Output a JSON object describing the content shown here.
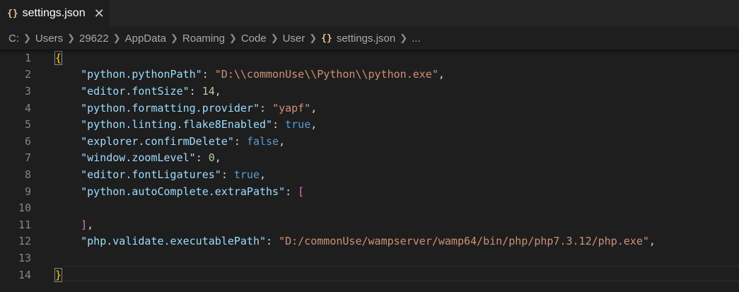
{
  "tab": {
    "icon": "{}",
    "label": "settings.json",
    "close": "✕"
  },
  "breadcrumbs": {
    "items": [
      "C:",
      "Users",
      "29622",
      "AppData",
      "Roaming",
      "Code",
      "User"
    ],
    "file_icon": "{}",
    "file": "settings.json",
    "more": "..."
  },
  "editor": {
    "lines": [
      {
        "n": "1",
        "tokens": [
          {
            "t": "{",
            "c": "brace"
          }
        ]
      },
      {
        "n": "2",
        "tokens": [
          {
            "t": "    ",
            "c": "punc"
          },
          {
            "t": "\"python.pythonPath\"",
            "c": "key"
          },
          {
            "t": ": ",
            "c": "punc"
          },
          {
            "t": "\"D:\\\\commonUse\\\\Python\\\\python.exe\"",
            "c": "str"
          },
          {
            "t": ",",
            "c": "punc"
          }
        ]
      },
      {
        "n": "3",
        "tokens": [
          {
            "t": "    ",
            "c": "punc"
          },
          {
            "t": "\"editor.fontSize\"",
            "c": "key"
          },
          {
            "t": ": ",
            "c": "punc"
          },
          {
            "t": "14",
            "c": "num"
          },
          {
            "t": ",",
            "c": "punc"
          }
        ]
      },
      {
        "n": "4",
        "tokens": [
          {
            "t": "    ",
            "c": "punc"
          },
          {
            "t": "\"python.formatting.provider\"",
            "c": "key"
          },
          {
            "t": ": ",
            "c": "punc"
          },
          {
            "t": "\"yapf\"",
            "c": "str"
          },
          {
            "t": ",",
            "c": "punc"
          }
        ]
      },
      {
        "n": "5",
        "tokens": [
          {
            "t": "    ",
            "c": "punc"
          },
          {
            "t": "\"python.linting.flake8Enabled\"",
            "c": "key"
          },
          {
            "t": ": ",
            "c": "punc"
          },
          {
            "t": "true",
            "c": "bool"
          },
          {
            "t": ",",
            "c": "punc"
          }
        ]
      },
      {
        "n": "6",
        "tokens": [
          {
            "t": "    ",
            "c": "punc"
          },
          {
            "t": "\"explorer.confirmDelete\"",
            "c": "key"
          },
          {
            "t": ": ",
            "c": "punc"
          },
          {
            "t": "false",
            "c": "bool"
          },
          {
            "t": ",",
            "c": "punc"
          }
        ]
      },
      {
        "n": "7",
        "tokens": [
          {
            "t": "    ",
            "c": "punc"
          },
          {
            "t": "\"window.zoomLevel\"",
            "c": "key"
          },
          {
            "t": ": ",
            "c": "punc"
          },
          {
            "t": "0",
            "c": "num"
          },
          {
            "t": ",",
            "c": "punc"
          }
        ]
      },
      {
        "n": "8",
        "tokens": [
          {
            "t": "    ",
            "c": "punc"
          },
          {
            "t": "\"editor.fontLigatures\"",
            "c": "key"
          },
          {
            "t": ": ",
            "c": "punc"
          },
          {
            "t": "true",
            "c": "bool"
          },
          {
            "t": ",",
            "c": "punc"
          }
        ]
      },
      {
        "n": "9",
        "tokens": [
          {
            "t": "    ",
            "c": "punc"
          },
          {
            "t": "\"python.autoComplete.extraPaths\"",
            "c": "key"
          },
          {
            "t": ": ",
            "c": "punc"
          },
          {
            "t": "[",
            "c": "bracket"
          }
        ]
      },
      {
        "n": "10",
        "tokens": []
      },
      {
        "n": "11",
        "tokens": [
          {
            "t": "    ",
            "c": "punc"
          },
          {
            "t": "]",
            "c": "bracket"
          },
          {
            "t": ",",
            "c": "punc"
          }
        ]
      },
      {
        "n": "12",
        "tokens": [
          {
            "t": "    ",
            "c": "punc"
          },
          {
            "t": "\"php.validate.executablePath\"",
            "c": "key"
          },
          {
            "t": ": ",
            "c": "punc"
          },
          {
            "t": "\"D:/commonUse/wampserver/wamp64/bin/php/php7.3.12/php.exe\"",
            "c": "str"
          },
          {
            "t": ",",
            "c": "punc"
          }
        ]
      },
      {
        "n": "13",
        "tokens": []
      },
      {
        "n": "14",
        "tokens": [
          {
            "t": "}",
            "c": "brace"
          }
        ]
      }
    ]
  },
  "colors": {
    "key": "#9cdcfe",
    "string": "#ce9178",
    "number": "#b5cea8",
    "boolean": "#569cd6",
    "bracket": "#da70d6",
    "brace": "#ffd700",
    "icon": "#e2c08d"
  }
}
